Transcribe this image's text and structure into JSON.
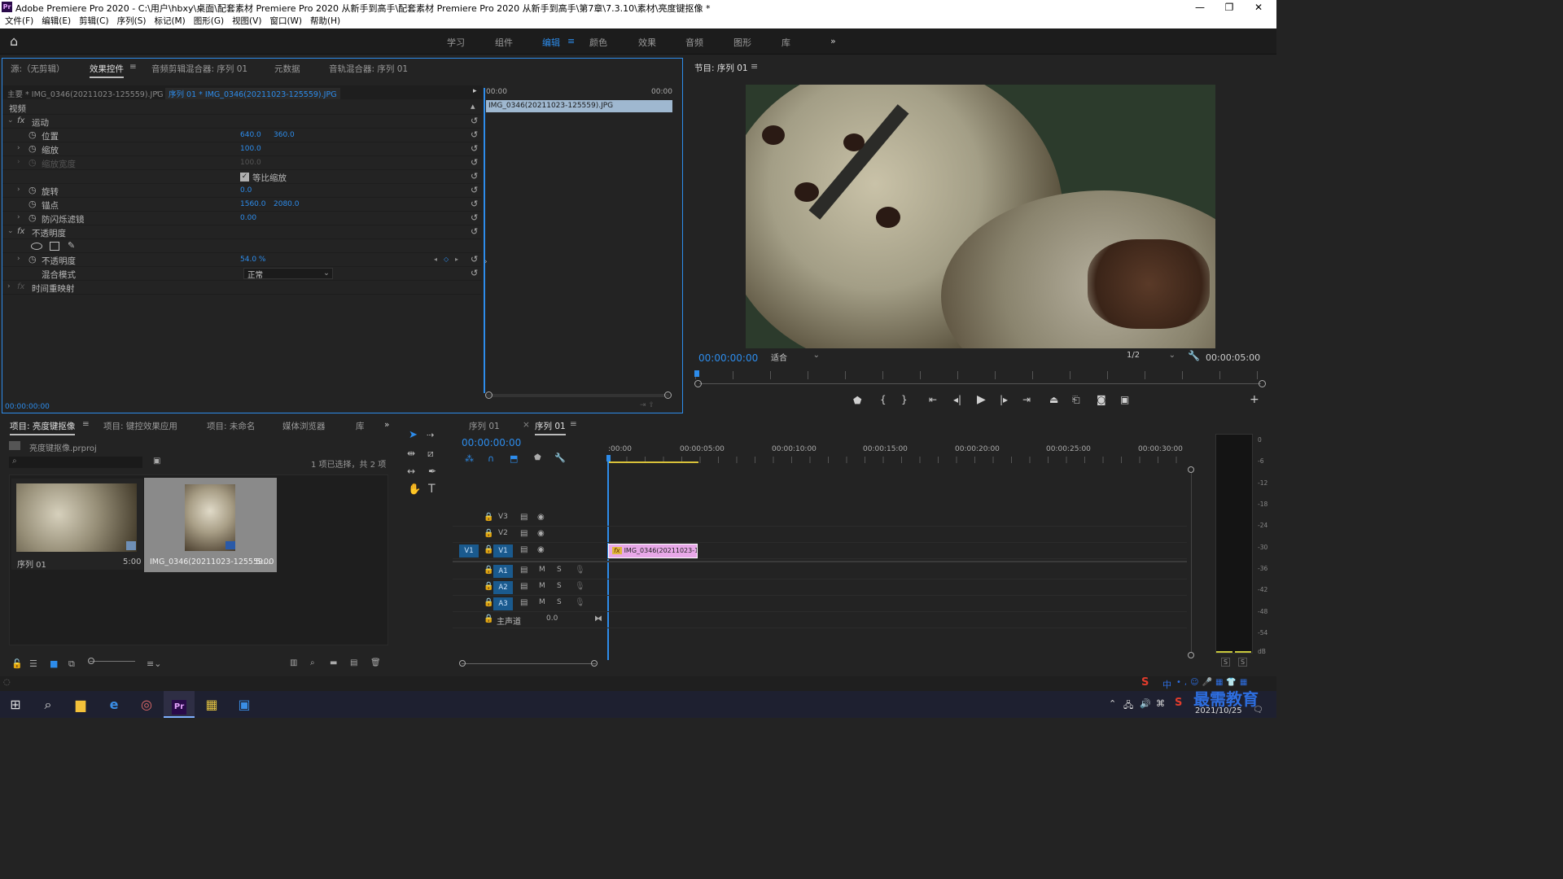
{
  "window": {
    "title": "Adobe Premiere Pro 2020 - C:\\用户\\hbxy\\桌面\\配套素材 Premiere Pro 2020 从新手到高手\\配套素材 Premiere Pro 2020 从新手到高手\\第7章\\7.3.10\\素材\\亮度键抠像 *",
    "app_icon": "Pr"
  },
  "menu": [
    "文件(F)",
    "编辑(E)",
    "剪辑(C)",
    "序列(S)",
    "标记(M)",
    "图形(G)",
    "视图(V)",
    "窗口(W)",
    "帮助(H)"
  ],
  "workspaces": [
    "学习",
    "组件",
    "编辑",
    "颜色",
    "效果",
    "音频",
    "图形",
    "库"
  ],
  "source_panel": {
    "tabs": [
      "源:（无剪辑）",
      "效果控件",
      "音频剪辑混合器: 序列 01",
      "元数据",
      "音轨混合器: 序列 01"
    ],
    "master_label": "主要 * IMG_0346(20211023-125559).JPG",
    "sequence_clip": "序列 01 * IMG_0346(20211023-125559).JPG",
    "timeline_start": "00:00",
    "timeline_end": "00:00",
    "clip_bar": "IMG_0346(20211023-125559).JPG",
    "section_video": "视频",
    "motion": "运动",
    "position": {
      "label": "位置",
      "x": "640.0",
      "y": "360.0"
    },
    "scale": {
      "label": "缩放",
      "value": "100.0"
    },
    "scale_width": {
      "label": "缩放宽度",
      "value": "100.0"
    },
    "uniform_scale": "等比缩放",
    "rotation": {
      "label": "旋转",
      "value": "0.0"
    },
    "anchor": {
      "label": "锚点",
      "x": "1560.0",
      "y": "2080.0"
    },
    "anti_flicker": {
      "label": "防闪烁滤镜",
      "value": "0.00"
    },
    "opacity_group": "不透明度",
    "opacity": {
      "label": "不透明度",
      "value": "54.0 %"
    },
    "blend_mode": {
      "label": "混合模式",
      "value": "正常"
    },
    "time_remap": "时间重映射",
    "timecode": "00:00:00:00"
  },
  "program_monitor": {
    "title": "节目: 序列 01",
    "timecode": "00:00:00:00",
    "fit": "适合",
    "resolution": "1/2",
    "duration": "00:00:05:00"
  },
  "project_panel": {
    "tabs": [
      "项目: 亮度键抠像",
      "项目: 键控效果应用",
      "项目: 未命名",
      "媒体浏览器",
      "库"
    ],
    "file": "亮度键抠像.prproj",
    "selection_info": "1 项已选择，共 2 项",
    "items": [
      {
        "name": "序列 01",
        "duration": "5:00"
      },
      {
        "name": "IMG_0346(20211023-125559...",
        "duration": "5:00"
      }
    ]
  },
  "timeline": {
    "tabs": [
      "序列 01",
      "序列 01"
    ],
    "timecode": "00:00:00:00",
    "ruler": [
      ":00:00",
      "00:00:05:00",
      "00:00:10:00",
      "00:00:15:00",
      "00:00:20:00",
      "00:00:25:00",
      "00:00:30:00"
    ],
    "tracks": [
      "V3",
      "V2",
      "V1",
      "A1",
      "A2",
      "A3"
    ],
    "source_target": "V1",
    "clip": "IMG_0346(20211023-12",
    "master": {
      "label": "主声道",
      "value": "0.0"
    },
    "mute": "M",
    "solo": "S"
  },
  "audio_meter": {
    "scale": [
      "0",
      "-6",
      "-12",
      "-18",
      "-24",
      "-30",
      "-36",
      "-42",
      "-48",
      "-54",
      "dB"
    ],
    "solo": [
      "S",
      "S"
    ]
  },
  "taskbar": {
    "time": "2021/10/25",
    "ime": "中",
    "watermark": "最需教育"
  }
}
